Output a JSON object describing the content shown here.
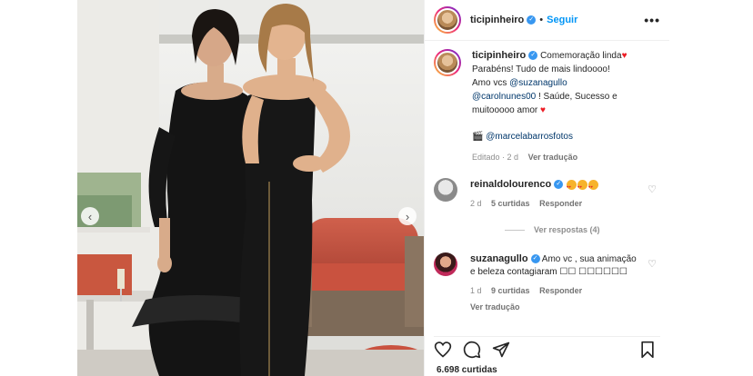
{
  "post": {
    "username": "ticipinheiro",
    "follow_label": "Seguir",
    "separator": "•",
    "more_label": "•••",
    "photo_alt": "Two women in black dresses posing together on a terrace",
    "carousel_prev_label": "‹",
    "carousel_next_label": "›"
  },
  "caption": {
    "username": "ticipinheiro",
    "text_line1": "Comemoração linda",
    "text_line2": "Parabéns! Tudo de mais lindoooo!",
    "text_line3_prefix": "Amo vcs",
    "mention1": "@suzanagullo",
    "mention2": "@carolnunes00",
    "text_after": "! Saúde, Sucesso e muitooooo amor",
    "heart": "♥",
    "credit_icon": "🎬",
    "credit_mention": "@marcelabarrosfotos",
    "edited": "Editado · 2 d",
    "translate": "Ver tradução"
  },
  "comments": [
    {
      "username": "reinaldolourenco",
      "text": "",
      "age": "2 d",
      "likes": "5 curtidas",
      "reply": "Responder",
      "view_replies": "Ver respostas (4)",
      "avatar_color": "#cfcfcf"
    },
    {
      "username": "suzanagullo",
      "text": "Amo vc , sua animação e beleza contagiaram ☐☐ ☐☐☐☐☐☐",
      "age": "1 d",
      "likes": "9 curtidas",
      "reply": "Responder",
      "translate": "Ver tradução",
      "avatar_color": "#c02a5a"
    }
  ],
  "actions": {
    "like_icon": "heart-outline",
    "comment_icon": "comment-bubble",
    "share_icon": "paper-plane",
    "save_icon": "bookmark",
    "likes_count": "6.698 curtidas"
  },
  "colors": {
    "accent": "#0095f6",
    "verified": "#3897f0",
    "mention": "#00376b",
    "muted": "#8e8e8e",
    "heart": "#ed1c24"
  }
}
